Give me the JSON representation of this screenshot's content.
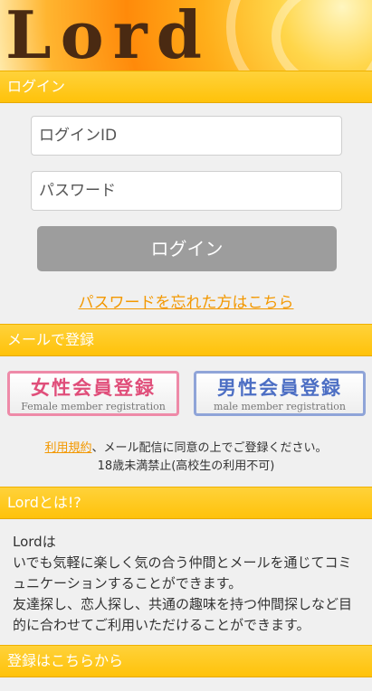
{
  "header": {
    "logo_text": "Lord"
  },
  "login": {
    "section_title": "ログイン",
    "id_placeholder": "ログインID",
    "password_placeholder": "パスワード",
    "login_button": "ログイン",
    "forgot_link": "パスワードを忘れた方はこちら"
  },
  "mail_register": {
    "section_title": "メールで登録",
    "female_button": {
      "jp": "女性会員登録",
      "en": "Female member registration"
    },
    "male_button": {
      "jp": "男性会員登録",
      "en": "male member registration"
    },
    "terms_link": "利用規約",
    "notice_rest": "、メール配信に同意の上でご登録ください。",
    "age_notice": "18歳未満禁止(高校生の利用不可)"
  },
  "about": {
    "section_title": "Lordとは!?",
    "lines": [
      "Lordは",
      "いでも気軽に楽しく気の合う仲間とメールを通じてコミュニケーションすることができます。",
      "友達探し、恋人探し、共通の趣味を持つ仲間探しなど目的に合わせてご利用いただけることができます。"
    ]
  },
  "register_here": {
    "section_title": "登録はこちらから"
  },
  "colors": {
    "accent": "#f39800",
    "bar": "#ffc20a",
    "female": "#e04e7a",
    "male": "#4d6fc4"
  }
}
